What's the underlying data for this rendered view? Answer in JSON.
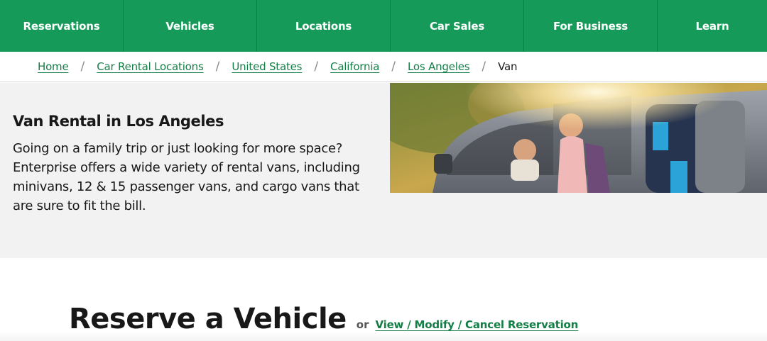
{
  "nav": {
    "items": [
      {
        "label": "Reservations"
      },
      {
        "label": "Vehicles"
      },
      {
        "label": "Locations"
      },
      {
        "label": "Car Sales"
      },
      {
        "label": "For Business"
      },
      {
        "label": "Learn"
      }
    ]
  },
  "breadcrumb": {
    "items": [
      {
        "label": "Home"
      },
      {
        "label": "Car Rental Locations"
      },
      {
        "label": "United States"
      },
      {
        "label": "California"
      },
      {
        "label": "Los Angeles"
      }
    ],
    "separator": "/",
    "current": "Van"
  },
  "hero": {
    "title": "Van Rental in Los Angeles",
    "body": "Going on a family trip or just looking for more space? Enterprise offers a wide variety of rental vans, including minivans, 12 & 15 passenger vans, and cargo vans that are sure to fit the bill."
  },
  "reserve": {
    "title": "Reserve a Vehicle",
    "or_label": "or",
    "manage_link": "View / Modify / Cancel Reservation"
  },
  "colors": {
    "brand_green": "#169a5a",
    "link_green": "#137e46",
    "hero_background": "#f2f2f2"
  }
}
